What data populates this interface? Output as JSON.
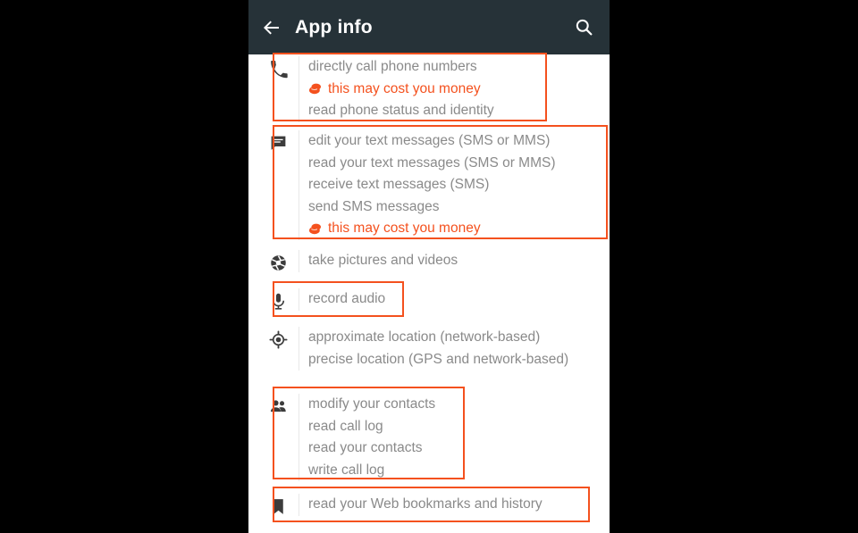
{
  "appbar": {
    "title": "App info",
    "back_icon": "arrow-back-icon",
    "search_icon": "search-icon"
  },
  "colors": {
    "appbar_bg": "#263238",
    "accent_orange": "#f4511e",
    "body_text": "#8a8a8a",
    "page_bg": "#ffffff",
    "frame_bg": "#000000"
  },
  "permission_groups": [
    {
      "icon": "phone-icon",
      "highlighted": true,
      "lines": [
        {
          "text": "directly call phone numbers",
          "style": "normal"
        },
        {
          "text": "this may cost you money",
          "style": "cost"
        },
        {
          "text": "read phone status and identity",
          "style": "normal"
        }
      ]
    },
    {
      "icon": "sms-message-icon",
      "highlighted": true,
      "lines": [
        {
          "text": "edit your text messages (SMS or MMS)",
          "style": "normal"
        },
        {
          "text": "read your text messages (SMS or MMS)",
          "style": "normal"
        },
        {
          "text": "receive text messages (SMS)",
          "style": "normal"
        },
        {
          "text": "send SMS messages",
          "style": "normal"
        },
        {
          "text": "this may cost you money",
          "style": "cost"
        }
      ]
    },
    {
      "icon": "camera-aperture-icon",
      "highlighted": false,
      "lines": [
        {
          "text": "take pictures and videos",
          "style": "normal"
        }
      ]
    },
    {
      "icon": "microphone-icon",
      "highlighted": true,
      "lines": [
        {
          "text": "record audio",
          "style": "normal"
        }
      ]
    },
    {
      "icon": "location-crosshair-icon",
      "highlighted": false,
      "lines": [
        {
          "text": "approximate location (network-based)",
          "style": "normal"
        },
        {
          "text": "precise location (GPS and network-based)",
          "style": "normal"
        }
      ]
    },
    {
      "icon": "contacts-people-icon",
      "highlighted": true,
      "lines": [
        {
          "text": "modify your contacts",
          "style": "normal"
        },
        {
          "text": "read call log",
          "style": "normal"
        },
        {
          "text": "read your contacts",
          "style": "normal"
        },
        {
          "text": "write call log",
          "style": "normal"
        }
      ]
    },
    {
      "icon": "bookmark-icon",
      "highlighted": true,
      "lines": [
        {
          "text": "read your Web bookmarks and history",
          "style": "normal"
        }
      ]
    }
  ]
}
